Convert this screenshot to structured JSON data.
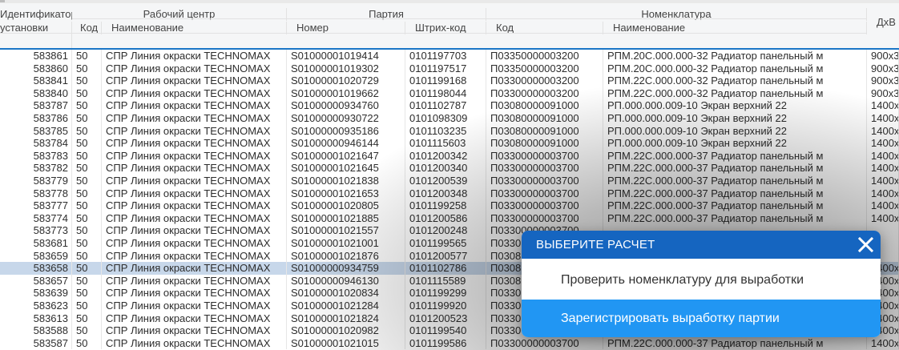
{
  "header": {
    "groups": {
      "identifier": "Идентификатор",
      "installation": "установки",
      "work_center": "Рабочий центр",
      "batch": "Партия",
      "nomenclature": "Номенклатура",
      "dxv": "ДхВ"
    },
    "sub": {
      "wc_code": "Код",
      "wc_name": "Наименование",
      "batch_number": "Номер",
      "barcode": "Штрих-код",
      "nom_code": "Код",
      "nom_name": "Наименование"
    }
  },
  "rows": [
    {
      "id": "583861",
      "code": "50",
      "wc": "СПР Линия окраски TECHNOMAX",
      "num": "S01000001019414",
      "bar": "0101197703",
      "ncode": "П03350000003200",
      "nname": "РПМ.20С.000.000-32 Радиатор панельный м",
      "dxv": "900x3"
    },
    {
      "id": "583860",
      "code": "50",
      "wc": "СПР Линия окраски TECHNOMAX",
      "num": "S01000001019302",
      "bar": "0101197517",
      "ncode": "П03350000003200",
      "nname": "РПМ.20С.000.000-32 Радиатор панельный м",
      "dxv": "900x3"
    },
    {
      "id": "583841",
      "code": "50",
      "wc": "СПР Линия окраски TECHNOMAX",
      "num": "S01000001020729",
      "bar": "0101199168",
      "ncode": "П03300000003200",
      "nname": "РПМ.22С.000.000-32 Радиатор панельный м",
      "dxv": "900x3"
    },
    {
      "id": "583840",
      "code": "50",
      "wc": "СПР Линия окраски TECHNOMAX",
      "num": "S01000001019662",
      "bar": "0101198044",
      "ncode": "П03300000003200",
      "nname": "РПМ.22С.000.000-32 Радиатор панельный м",
      "dxv": "900x3"
    },
    {
      "id": "583787",
      "code": "50",
      "wc": "СПР Линия окраски TECHNOMAX",
      "num": "S01000000934760",
      "bar": "0101102787",
      "ncode": "П03080000091000",
      "nname": "РП.000.000.009-10 Экран верхний 22",
      "dxv": "1400x"
    },
    {
      "id": "583786",
      "code": "50",
      "wc": "СПР Линия окраски TECHNOMAX",
      "num": "S01000000930722",
      "bar": "0101098309",
      "ncode": "П03080000091000",
      "nname": "РП.000.000.009-10 Экран верхний 22",
      "dxv": "1400x"
    },
    {
      "id": "583785",
      "code": "50",
      "wc": "СПР Линия окраски TECHNOMAX",
      "num": "S01000000935186",
      "bar": "0101103235",
      "ncode": "П03080000091000",
      "nname": "РП.000.000.009-10 Экран верхний 22",
      "dxv": "1400x"
    },
    {
      "id": "583784",
      "code": "50",
      "wc": "СПР Линия окраски TECHNOMAX",
      "num": "S01000000946144",
      "bar": "0101115603",
      "ncode": "П03080000091000",
      "nname": "РП.000.000.009-10 Экран верхний 22",
      "dxv": "1400x"
    },
    {
      "id": "583783",
      "code": "50",
      "wc": "СПР Линия окраски TECHNOMAX",
      "num": "S01000001021647",
      "bar": "0101200342",
      "ncode": "П03300000003700",
      "nname": "РПМ.22С.000.000-37 Радиатор панельный м",
      "dxv": "1400x"
    },
    {
      "id": "583782",
      "code": "50",
      "wc": "СПР Линия окраски TECHNOMAX",
      "num": "S01000001021645",
      "bar": "0101200340",
      "ncode": "П03300000003700",
      "nname": "РПМ.22С.000.000-37 Радиатор панельный м",
      "dxv": "1400x"
    },
    {
      "id": "583779",
      "code": "50",
      "wc": "СПР Линия окраски TECHNOMAX",
      "num": "S01000001021838",
      "bar": "0101200539",
      "ncode": "П03300000003700",
      "nname": "РПМ.22С.000.000-37 Радиатор панельный м",
      "dxv": "1400x"
    },
    {
      "id": "583778",
      "code": "50",
      "wc": "СПР Линия окраски TECHNOMAX",
      "num": "S01000001021653",
      "bar": "0101200348",
      "ncode": "П03300000003700",
      "nname": "РПМ.22С.000.000-37 Радиатор панельный м",
      "dxv": "1400x"
    },
    {
      "id": "583777",
      "code": "50",
      "wc": "СПР Линия окраски TECHNOMAX",
      "num": "S01000001020805",
      "bar": "0101199258",
      "ncode": "П03300000003700",
      "nname": "РПМ.22С.000.000-37 Радиатор панельный м",
      "dxv": "1400x"
    },
    {
      "id": "583774",
      "code": "50",
      "wc": "СПР Линия окраски TECHNOMAX",
      "num": "S01000001021885",
      "bar": "0101200586",
      "ncode": "П03300000003700",
      "nname": "РПМ.22С.000.000-37 Радиатор панельный м",
      "dxv": "1400x"
    },
    {
      "id": "583773",
      "code": "50",
      "wc": "СПР Линия окраски TECHNOMAX",
      "num": "S01000001021557",
      "bar": "0101200248",
      "ncode": "П03300000003700",
      "nname": "",
      "dxv": ""
    },
    {
      "id": "583681",
      "code": "50",
      "wc": "СПР Линия окраски TECHNOMAX",
      "num": "S01000001021001",
      "bar": "0101199565",
      "ncode": "П0330",
      "nname": "",
      "dxv": ""
    },
    {
      "id": "583659",
      "code": "50",
      "wc": "СПР Линия окраски TECHNOMAX",
      "num": "S01000001021876",
      "bar": "0101200577",
      "ncode": "П0308",
      "nname": "",
      "dxv": ""
    },
    {
      "id": "583658",
      "code": "50",
      "wc": "СПР Линия окраски TECHNOMAX",
      "num": "S01000000934759",
      "bar": "0101102786",
      "ncode": "П0308",
      "nname": "",
      "dxv": "1400x",
      "selected": true
    },
    {
      "id": "583657",
      "code": "50",
      "wc": "СПР Линия окраски TECHNOMAX",
      "num": "S01000000946130",
      "bar": "0101115589",
      "ncode": "П0308",
      "nname": "",
      "dxv": "1400x"
    },
    {
      "id": "583639",
      "code": "50",
      "wc": "СПР Линия окраски TECHNOMAX",
      "num": "S01000001020834",
      "bar": "0101199299",
      "ncode": "П0330",
      "nname": "",
      "dxv": "1400x"
    },
    {
      "id": "583623",
      "code": "50",
      "wc": "СПР Линия окраски TECHNOMAX",
      "num": "S01000001021284",
      "bar": "0101199920",
      "ncode": "П0330",
      "nname": "",
      "dxv": "1400x"
    },
    {
      "id": "583613",
      "code": "50",
      "wc": "СПР Линия окраски TECHNOMAX",
      "num": "S01000001021824",
      "bar": "0101200523",
      "ncode": "П0330",
      "nname": "",
      "dxv": "1400x"
    },
    {
      "id": "583588",
      "code": "50",
      "wc": "СПР Линия окраски TECHNOMAX",
      "num": "S01000001020982",
      "bar": "0101199540",
      "ncode": "П0330",
      "nname": "",
      "dxv": "1400x"
    },
    {
      "id": "583587",
      "code": "50",
      "wc": "СПР Линия окраски TECHNOMAX",
      "num": "S01000001021015",
      "bar": "0101199586",
      "ncode": "П03300000003700",
      "nname": "РПМ.22С.000.000-37 Радиатор панельный м",
      "dxv": "1400x"
    }
  ],
  "dialog": {
    "title": "ВЫБЕРИТЕ РАСЧЕТ",
    "options": [
      "Проверить номенклатуру для выработки",
      "Зарегистрировать выработку партии"
    ],
    "colors": {
      "header": "#1565c0",
      "highlight": "#2196f3",
      "selected_row": "#c7d7ea",
      "header_underline": "#1b76c6"
    }
  }
}
